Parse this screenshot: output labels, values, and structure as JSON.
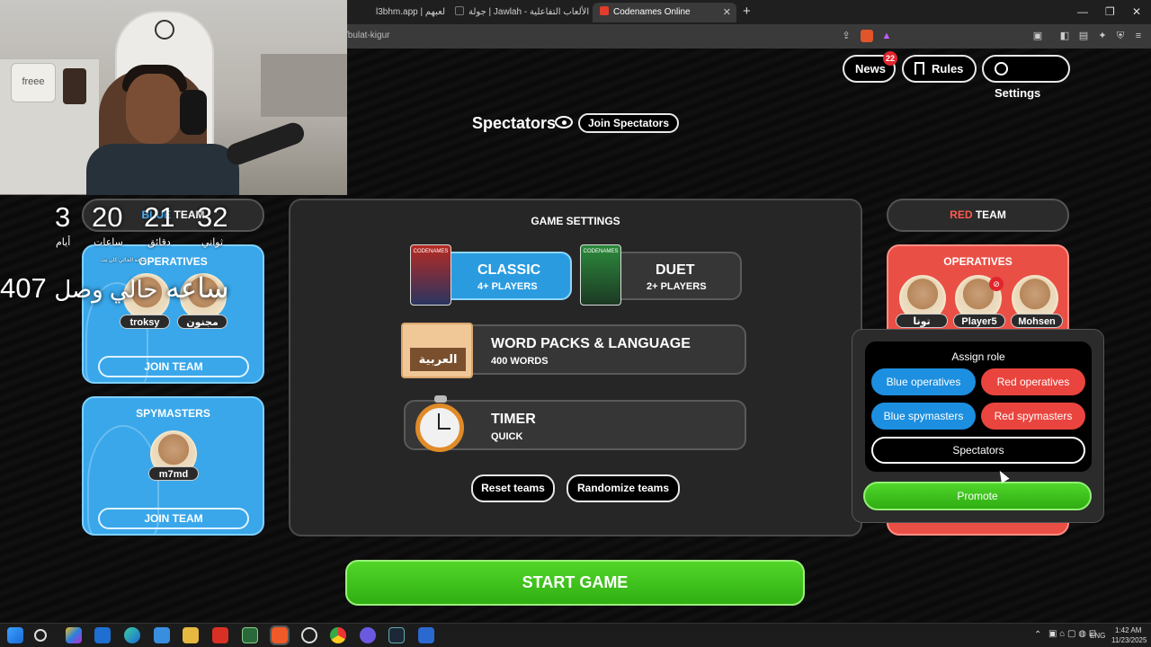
{
  "browser": {
    "tabs": [
      {
        "label": "l3bhm.app | لعبهم"
      },
      {
        "label": "جولة | Jawlah - منصة الألعاب التفاعلية"
      },
      {
        "label": "Codenames Online"
      }
    ],
    "url": "/bulat-kigur",
    "new_tab": "+",
    "window_controls": {
      "minimize": "—",
      "restore": "❐",
      "close": "✕"
    }
  },
  "webcam": {
    "jar_label": "freee"
  },
  "countdown": {
    "days": "3",
    "days_label": "أيام",
    "hours": "20",
    "hours_label": "ساعات",
    "minutes": "21",
    "minutes_label": "دقائق",
    "seconds": "32",
    "seconds_label": "ثواني",
    "big_hours": "407 ساعه",
    "status_prefix": "حالي وصل",
    "small_status": "ساعه الحالي كان نت"
  },
  "nav": {
    "news": "News",
    "news_badge": "22",
    "rules": "Rules",
    "settings": "Settings"
  },
  "spectators": {
    "title": "Spectators",
    "join_label": "Join Spectators"
  },
  "blue_team": {
    "header_prefix": "BLUE",
    "header_suffix": "TEAM",
    "operatives_title": "OPERATIVES",
    "operatives": [
      "troksy",
      "مجنون"
    ],
    "join_team": "JOIN TEAM",
    "spymasters_title": "SPYMASTERS",
    "spymasters": [
      "m7md"
    ],
    "join_team_2": "JOIN TEAM"
  },
  "red_team": {
    "header_prefix": "RED",
    "header_suffix": "TEAM",
    "operatives_title": "OPERATIVES",
    "operatives": [
      "تونا",
      "Player5",
      "Mohsen"
    ]
  },
  "game_settings": {
    "title": "GAME SETTINGS",
    "classic": {
      "title": "CLASSIC",
      "sub": "4+ PLAYERS",
      "box": "CODENAMES"
    },
    "duet": {
      "title": "DUET",
      "sub": "2+ PLAYERS",
      "box": "CODENAMES"
    },
    "word_packs": {
      "title": "WORD PACKS & LANGUAGE",
      "sub": "400 WORDS",
      "language": "العربية"
    },
    "timer": {
      "title": "TIMER",
      "sub": "QUICK"
    },
    "reset_teams": "Reset teams",
    "randomize_teams": "Randomize teams"
  },
  "start_game": "START GAME",
  "assign_role": {
    "title": "Assign role",
    "blue_operatives": "Blue operatives",
    "red_operatives": "Red operatives",
    "blue_spymasters": "Blue spymasters",
    "red_spymasters": "Red spymasters",
    "spectators": "Spectators",
    "promote": "Promote"
  },
  "taskbar": {
    "language": "ENG",
    "time": "1:42 AM",
    "date": "11/23/2025"
  },
  "colors": {
    "blue_team": "#39a7ea",
    "red_team": "#ea4f46",
    "start_green": "#3fbf1c",
    "red_accent": "#e0262c"
  }
}
